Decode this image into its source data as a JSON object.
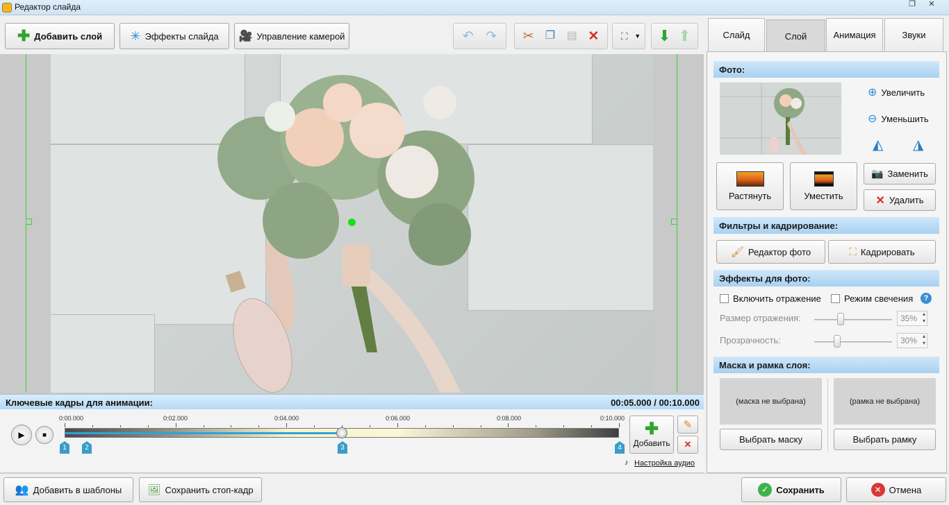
{
  "window": {
    "title": "Редактор слайда"
  },
  "toolbar": {
    "add_layer": "Добавить слой",
    "slide_effects": "Эффекты слайда",
    "camera_control": "Управление камерой"
  },
  "keyframes": {
    "header": "Ключевые кадры для анимации:",
    "time": "00:05.000 / 00:10.000",
    "labels": [
      "0:00.000",
      "0:02.000",
      "0:04.000",
      "0:06.000",
      "0:08.000",
      "0:10.000"
    ],
    "markers": [
      "1",
      "2",
      "3",
      "4"
    ],
    "add": "Добавить",
    "audio": "Настройка аудио",
    "progress_fraction": 0.5
  },
  "tabs": [
    "Слайд",
    "Слой",
    "Анимация",
    "Звуки"
  ],
  "photo": {
    "header": "Фото:",
    "zoom_in": "Увеличить",
    "zoom_out": "Уменьшить",
    "stretch": "Растянуть",
    "fit": "Уместить",
    "replace": "Заменить",
    "delete": "Удалить"
  },
  "filters": {
    "header": "Фильтры и кадрирование:",
    "editor": "Редактор фото",
    "crop": "Кадрировать"
  },
  "effects": {
    "header": "Эффекты для фото:",
    "reflection": "Включить отражение",
    "glow": "Режим свечения",
    "reflection_size": "Размер отражения:",
    "reflection_size_value": "35%",
    "transparency": "Прозрачность:",
    "transparency_value": "30%"
  },
  "mask": {
    "header": "Маска и рамка слоя:",
    "mask_none": "(маска не выбрана)",
    "frame_none": "(рамка не выбрана)",
    "choose_mask": "Выбрать маску",
    "choose_frame": "Выбрать рамку"
  },
  "footer": {
    "add_template": "Добавить в шаблоны",
    "save_frame": "Сохранить стоп-кадр",
    "save": "Сохранить",
    "cancel": "Отмена"
  },
  "colors": {
    "accent_blue": "#3a9cc8",
    "guide_green": "#3ad13a"
  }
}
